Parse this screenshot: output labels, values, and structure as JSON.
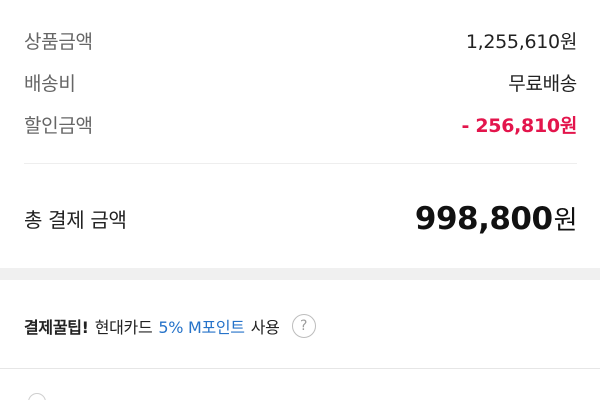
{
  "summary": {
    "product_amount": {
      "label": "상품금액",
      "value": "1,255,610",
      "unit": "원"
    },
    "shipping": {
      "label": "배송비",
      "value": "무료배송"
    },
    "discount": {
      "label": "할인금액",
      "value": "- 256,810",
      "unit": "원"
    }
  },
  "total": {
    "label": "총 결제 금액",
    "value": "998,800",
    "unit": "원"
  },
  "tip": {
    "title": "결제꿀팁!",
    "prefix": "현대카드",
    "highlight": "5% M포인트",
    "suffix": "사용",
    "help_icon": "?"
  },
  "colors": {
    "discount": "#e3154c",
    "highlight": "#2673c9",
    "section_gap": "#f0f0f0"
  }
}
